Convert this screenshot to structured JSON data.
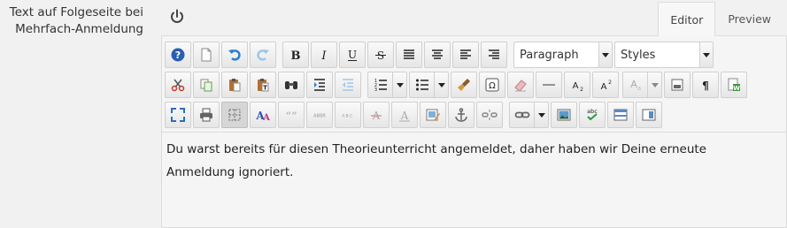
{
  "field": {
    "label": "Text auf Folgeseite bei Mehrfach-Anmeldung"
  },
  "power_icon": "power-icon",
  "tabs": [
    {
      "label": "Editor",
      "active": true
    },
    {
      "label": "Preview",
      "active": false
    }
  ],
  "toolbar": {
    "format_select": "Paragraph",
    "styles_select": "Styles",
    "row1": [
      "help-icon",
      "new-document-icon",
      "undo-icon",
      "redo-icon",
      "bold-icon",
      "italic-icon",
      "underline-icon",
      "strikethrough-icon",
      "justify-icon",
      "align-center-icon",
      "align-left-icon",
      "align-right-icon"
    ],
    "row2": [
      "cut-icon",
      "copy-icon",
      "paste-icon",
      "paste-text-icon",
      "find-replace-icon",
      "indent-icon",
      "outdent-icon",
      "numbered-list-icon",
      "bullet-list-icon",
      "clear-format-icon",
      "special-char-icon",
      "eraser-icon",
      "horizontal-rule-icon",
      "subscript-icon",
      "superscript-icon",
      "text-color-icon",
      "page-break-icon",
      "pilcrow-icon",
      "paste-word-icon"
    ],
    "row3": [
      "fullscreen-icon",
      "print-icon",
      "visual-aid-icon",
      "font-style-icon",
      "blockquote-icon",
      "abbreviation-icon",
      "acronym-icon",
      "remove-format-icon",
      "text-style-icon",
      "edit-image-icon",
      "anchor-icon",
      "unlink-icon",
      "link-icon",
      "image-icon",
      "spellcheck-icon",
      "template-icon",
      "insert-layer-icon"
    ],
    "abbr_label": "ABBR",
    "acronym_label": "A.B.C.",
    "spell_label": "abc"
  },
  "content": {
    "text": "Du warst bereits für diesen Theorieunterricht angemeldet, daher haben wir Deine erneute Anmeldung ignoriert."
  },
  "colors": {
    "accent_blue": "#2a6fbf",
    "border": "#dcdcdc",
    "background": "#f1f1f1"
  }
}
